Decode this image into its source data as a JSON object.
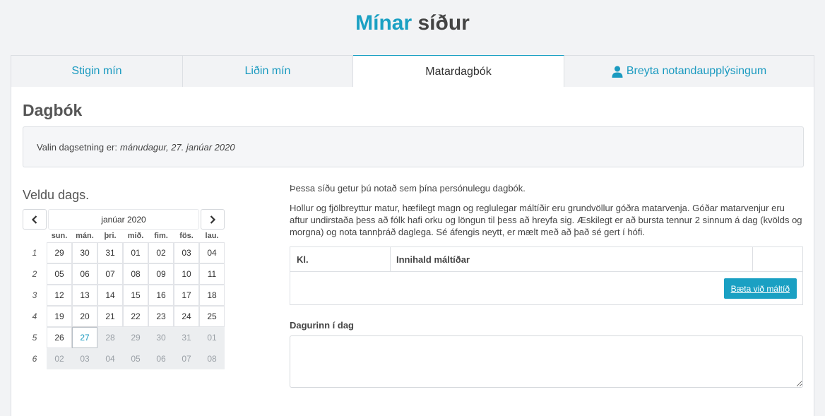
{
  "header": {
    "title_accent": "Mínar",
    "title_rest": "síður"
  },
  "tabs": [
    {
      "label": "Stigin mín",
      "active": false
    },
    {
      "label": "Liðin mín",
      "active": false
    },
    {
      "label": "Matardagbók",
      "active": true
    },
    {
      "label": "Breyta notandaupplýsingum",
      "active": false,
      "icon": "user-icon"
    }
  ],
  "section": {
    "title": "Dagbók"
  },
  "selected_date": {
    "prefix": "Valin dagsetning er:",
    "value": "mánudagur, 27. janúar 2020"
  },
  "calendar": {
    "title": "Veldu dags.",
    "month_label": "janúar 2020",
    "prev_icon": "chevron-left-icon",
    "next_icon": "chevron-right-icon",
    "weekdays": [
      "sun.",
      "mán.",
      "þri.",
      "mið.",
      "fim.",
      "fös.",
      "lau."
    ],
    "weeks": [
      {
        "num": "1",
        "days": [
          "29",
          "30",
          "31",
          "01",
          "02",
          "03",
          "04"
        ]
      },
      {
        "num": "2",
        "days": [
          "05",
          "06",
          "07",
          "08",
          "09",
          "10",
          "11"
        ]
      },
      {
        "num": "3",
        "days": [
          "12",
          "13",
          "14",
          "15",
          "16",
          "17",
          "18"
        ]
      },
      {
        "num": "4",
        "days": [
          "19",
          "20",
          "21",
          "22",
          "23",
          "24",
          "25"
        ]
      },
      {
        "num": "5",
        "days": [
          "26",
          "27",
          "28",
          "29",
          "30",
          "31",
          "01"
        ]
      },
      {
        "num": "6",
        "days": [
          "02",
          "03",
          "04",
          "05",
          "06",
          "07",
          "08"
        ]
      }
    ],
    "selected_day": "27"
  },
  "intro": {
    "line1": "Þessa síðu getur þú notað sem þína persónulegu dagbók.",
    "line2": "Hollur og fjölbreyttur matur, hæfilegt magn og reglulegar máltíðir eru grundvöllur góðra matarvenja. Góðar matarvenjur eru aftur undirstaða þess að fólk hafi orku og löngun til þess að hreyfa sig. Æskilegt er að bursta tennur 2 sinnum á dag (kvölds og morgna) og nota tannþráð daglega. Sé áfengis neytt, er mælt með að það sé gert í hófi."
  },
  "meal_table": {
    "col_time": "Kl.",
    "col_content": "Innihald máltíðar",
    "add_button": "Bæta við máltíð"
  },
  "day_note": {
    "label": "Dagurinn í dag",
    "value": ""
  },
  "colors": {
    "accent": "#1aa0c3",
    "background": "#f2f3f5"
  }
}
